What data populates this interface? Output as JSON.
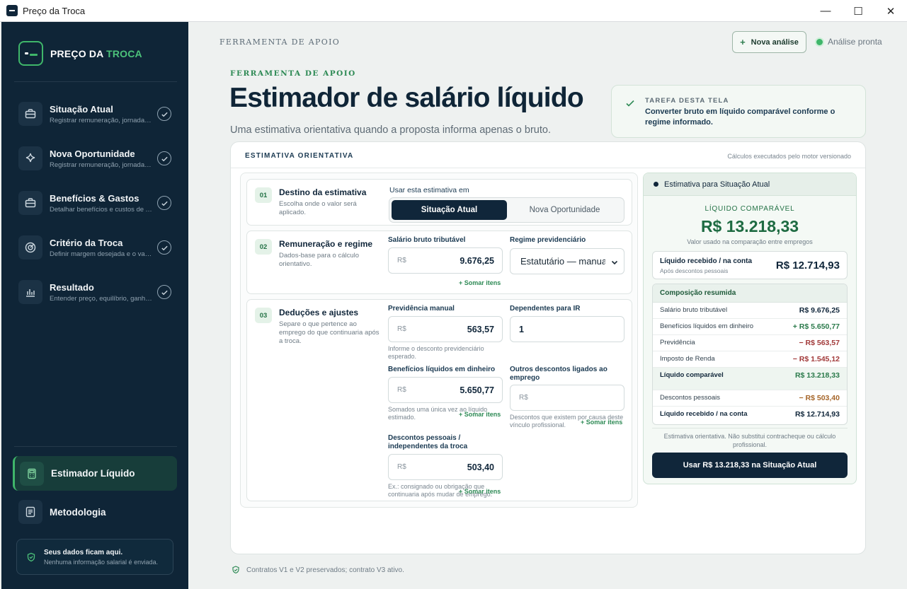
{
  "window": {
    "title": "Preço da Troca",
    "controls": [
      "—",
      "☐",
      "✕"
    ]
  },
  "brand": {
    "part1": "PREÇO DA ",
    "part2": "TROCA"
  },
  "sidebar": {
    "items": [
      {
        "title": "Situação Atual",
        "sub": "Registrar remuneração, jornada e ...",
        "icon": "briefcase-icon"
      },
      {
        "title": "Nova Oportunidade",
        "sub": "Registrar remuneração, jornada e ...",
        "icon": "sparkle-icon"
      },
      {
        "title": "Benefícios & Gastos",
        "sub": "Detalhar benefícios e custos de At...",
        "icon": "briefcase-icon"
      },
      {
        "title": "Critério da Troca",
        "sub": "Definir margem desejada e o valor...",
        "icon": "target-icon"
      },
      {
        "title": "Resultado",
        "sub": "Entender preço, equilíbrio, ganho ...",
        "icon": "bar-chart-icon"
      }
    ],
    "active": {
      "title": "Estimador Líquido",
      "icon": "calculator-icon"
    },
    "methodology": {
      "title": "Metodologia",
      "icon": "document-icon"
    },
    "privacy": {
      "title": "Seus dados ficam aqui.",
      "sub": "Nenhuma informação salarial é enviada."
    }
  },
  "topbar": {
    "label": "FERRAMENTA DE APOIO",
    "new_button": "Nova análise",
    "status": "Análise pronta"
  },
  "header": {
    "eyebrow": "FERRAMENTA DE APOIO",
    "title": "Estimador de salário líquido",
    "subtitle": "Uma estimativa orientativa quando a proposta informa apenas o bruto."
  },
  "task": {
    "label": "TAREFA DESTA TELA",
    "text": "Converter bruto em líquido comparável conforme o regime informado."
  },
  "card": {
    "header": "ESTIMATIVA ORIENTATIVA",
    "engine": "Cálculos executados pelo motor versionado"
  },
  "section1": {
    "num": "01",
    "title": "Destino da estimativa",
    "desc": "Escolha onde o valor será aplicado.",
    "use_label": "Usar esta estimativa em",
    "option_active": "Situação Atual",
    "option_inactive": "Nova Oportunidade"
  },
  "section2": {
    "num": "02",
    "title": "Remuneração e regime",
    "desc": "Dados-base para o cálculo orientativo.",
    "gross_label": "Salário bruto tributável",
    "currency": "R$",
    "gross_value": "9.676,25",
    "regime_label": "Regime previdenciário",
    "regime_value": "Estatutário — manual",
    "add_items": "+ Somar itens"
  },
  "section3": {
    "num": "03",
    "title": "Deduções e ajustes",
    "desc": "Separe o que pertence ao emprego do que continuaria após a troca.",
    "prev_label": "Previdência manual",
    "prev_value": "563,57",
    "prev_hint": "Informe o desconto previdenciário esperado.",
    "dep_label": "Dependentes para IR",
    "dep_value": "1",
    "ben_label": "Benefícios líquidos em dinheiro",
    "ben_value": "5.650,77",
    "ben_hint": "Somados uma única vez ao líquido estimado.",
    "other_label": "Outros descontos ligados ao emprego",
    "other_hint": "Descontos que existem por causa deste vínculo profissional.",
    "personal_label": "Descontos pessoais / independentes da troca",
    "personal_value": "503,40",
    "personal_hint": "Ex.: consignado ou obrigação que continuaria após mudar de emprego.",
    "currency": "R$",
    "add_items": "+ Somar itens"
  },
  "result": {
    "head": "Estimativa para Situação Atual",
    "liq_label": "LÍQUIDO COMPARÁVEL",
    "liq_value": "R$ 13.218,33",
    "liq_sub": "Valor usado na comparação entre empregos",
    "received_label": "Líquido recebido / na conta",
    "received_sub": "Após descontos pessoais",
    "received_value": "R$ 12.714,93",
    "comp_head": "Composição resumida",
    "rows": [
      {
        "k": "Salário bruto tributável",
        "v": "R$ 9.676,25"
      },
      {
        "k": "Benefícios líquidos em dinheiro",
        "v": "+ R$ 5.650,77"
      },
      {
        "k": "Previdência",
        "v": "− R$ 563,57"
      },
      {
        "k": "Imposto de Renda",
        "v": "− R$ 1.545,12"
      },
      {
        "k": "Líquido comparável",
        "v": "R$ 13.218,33"
      },
      {
        "k": "Descontos pessoais",
        "v": "− R$ 503,40"
      },
      {
        "k": "Líquido recebido / na conta",
        "v": "R$ 12.714,93"
      }
    ],
    "note": "Estimativa orientativa. Não substitui contracheque ou cálculo profissional.",
    "button": "Usar R$ 13.218,33 na Situação Atual"
  },
  "footer": {
    "text": "Contratos V1 e V2 preservados; contrato V3 ativo."
  },
  "colors": {
    "sidebar": "#0f2537",
    "accent": "#3fb66a",
    "positive": "#2b7a4b",
    "negative": "#a23a3a"
  }
}
